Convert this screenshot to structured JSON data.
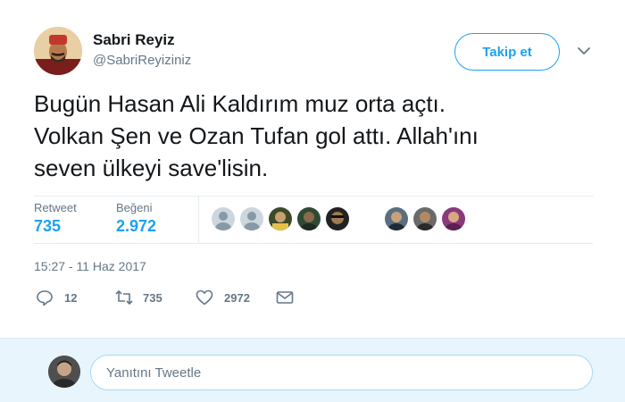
{
  "author": {
    "name": "Sabri Reyiz",
    "handle": "@SabriReyiziniz"
  },
  "follow_button": {
    "label": "Takip et"
  },
  "tweet": {
    "lines": [
      "Bugün Hasan Ali Kaldırım muz orta açtı.",
      "Volkan Şen ve Ozan Tufan gol attı. Allah'ını",
      "seven ülkeyi save'lisin."
    ],
    "timestamp": "15:27 - 11 Haz 2017"
  },
  "stats": {
    "retweets": {
      "label": "Retweet",
      "value": "735"
    },
    "likes": {
      "label": "Beğeni",
      "value": "2.972"
    }
  },
  "actions": {
    "reply_count": "12",
    "retweet_count": "735",
    "like_count": "2972"
  },
  "reply_box": {
    "placeholder": "Yanıtını Tweetle"
  },
  "colors": {
    "accent": "#1da1f2",
    "muted_text": "#657786",
    "reply_bar_bg": "#e8f5fd"
  },
  "icons": [
    "chevron-down-icon",
    "reply-icon",
    "retweet-icon",
    "heart-icon",
    "envelope-icon"
  ]
}
